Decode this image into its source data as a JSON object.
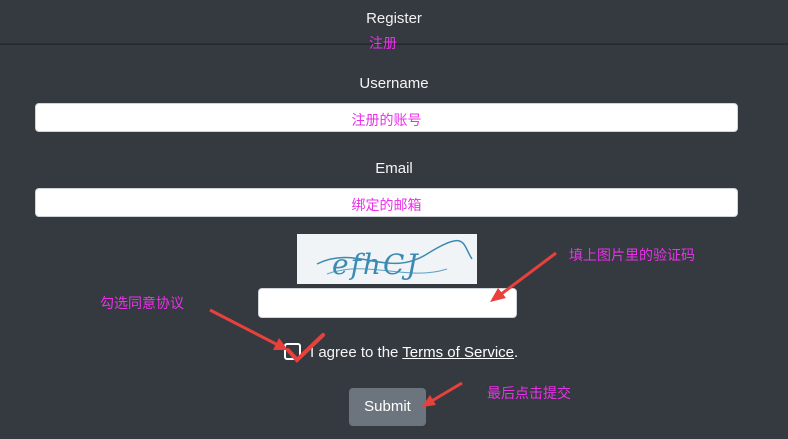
{
  "header": {
    "title": "Register",
    "annotation": "注册"
  },
  "form": {
    "username_label": "Username",
    "username_annotation": "注册的账号",
    "email_label": "Email",
    "email_annotation": "绑定的邮箱",
    "captcha_text": "efhCJ",
    "captcha_annotation": "填上图片里的验证码",
    "agree_prefix": "I agree to the ",
    "tos_link": "Terms of Service",
    "agree_suffix": ".",
    "agree_annotation": "勾选同意协议",
    "submit_label": "Submit",
    "submit_annotation": "最后点击提交"
  },
  "colors": {
    "background": "#353a40",
    "annotation": "#e832e8",
    "arrow": "#e8413c",
    "button": "#6c757d"
  }
}
